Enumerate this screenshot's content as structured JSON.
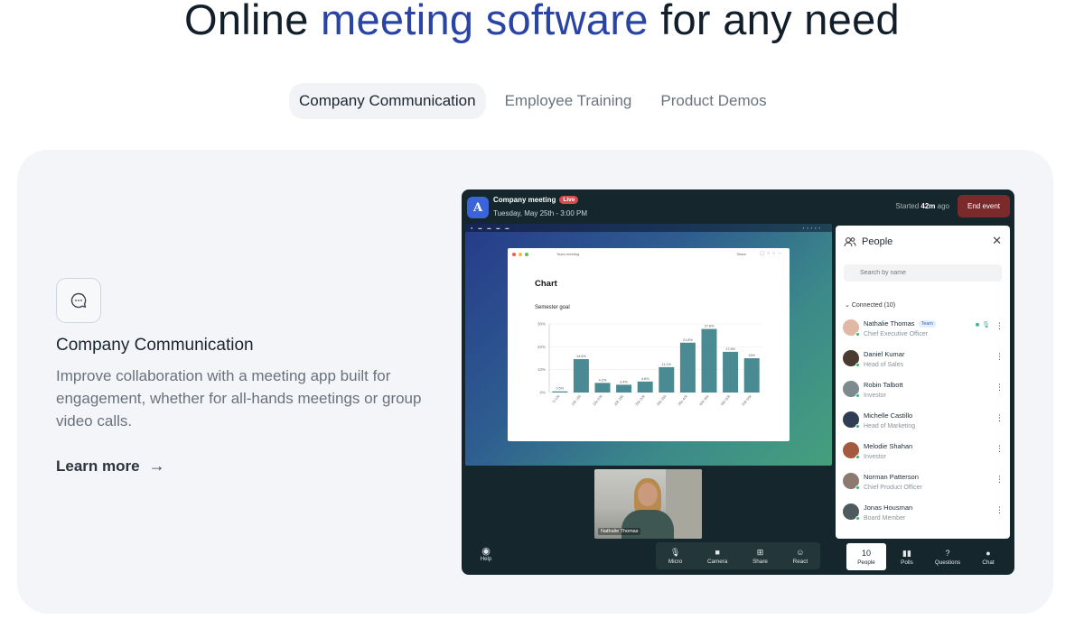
{
  "headline": {
    "pre": "Online ",
    "accent": "meeting software",
    "post": " for any need"
  },
  "tabs": [
    {
      "label": "Company Communication",
      "active": true
    },
    {
      "label": "Employee Training",
      "active": false
    },
    {
      "label": "Product Demos",
      "active": false
    }
  ],
  "feature": {
    "icon": "chat-bubble-icon",
    "title": "Company Communication",
    "description": "Improve collaboration with a meeting app built for engagement, whether for all-hands meetings or group video calls.",
    "link_label": "Learn more",
    "link_arrow": "→"
  },
  "app": {
    "logo_letter": "A",
    "meeting_title": "Company meeting",
    "live_badge": "Live",
    "meeting_date": "Tuesday, May 25th - 3:00 PM",
    "started_prefix": "Started ",
    "started_value": "42m",
    "started_suffix": " ago",
    "end_button": "End event",
    "shared_window": {
      "window_title": "Team meeting",
      "share_label": "Share",
      "chart_title": "Chart",
      "chart_subtitle": "Semester goal"
    },
    "thumbnail_name": "Nathalie Thomas",
    "help_label": "Help",
    "controls": [
      {
        "label": "Micro",
        "icon": "microphone-icon"
      },
      {
        "label": "Camera",
        "icon": "camera-icon"
      },
      {
        "label": "Share",
        "icon": "share-screen-icon"
      },
      {
        "label": "React",
        "icon": "smiley-icon"
      }
    ],
    "panel": {
      "title": "People",
      "search_placeholder": "Search by name",
      "connected_label": "Connected (10)",
      "people": [
        {
          "name": "Nathalie Thomas",
          "role": "Chief Executive Officer",
          "badge": "Team",
          "avatar_color": "#e0b9a4"
        },
        {
          "name": "Daniel Kumar",
          "role": "Head of Sales",
          "badge": "",
          "avatar_color": "#4b3a30"
        },
        {
          "name": "Robin Talbott",
          "role": "Investor",
          "badge": "",
          "avatar_color": "#7d8a90"
        },
        {
          "name": "Michelle Castillo",
          "role": "Head of Marketing",
          "badge": "",
          "avatar_color": "#2f3d55"
        },
        {
          "name": "Melodie Shahan",
          "role": "Investor",
          "badge": "",
          "avatar_color": "#a35a3e"
        },
        {
          "name": "Norman Patterson",
          "role": "Chief Product Officer",
          "badge": "",
          "avatar_color": "#8c7a70"
        },
        {
          "name": "Jonas Housman",
          "role": "Board Member",
          "badge": "",
          "avatar_color": "#4f5a5e"
        }
      ]
    },
    "panel_tabs": [
      {
        "label": "People",
        "count": "10",
        "active": true,
        "icon": "people-count"
      },
      {
        "label": "Polls",
        "active": false,
        "icon": "polls-icon"
      },
      {
        "label": "Questions",
        "active": false,
        "icon": "question-icon"
      },
      {
        "label": "Chat",
        "active": false,
        "icon": "chat-icon"
      }
    ]
  },
  "chart_data": {
    "type": "bar",
    "title": "Chart",
    "subtitle": "Semester goal",
    "categories": [
      "0-10k",
      "10k-15k",
      "15k-20k",
      "20k-25k",
      "25k-30k",
      "30k-35k",
      "35k-40k",
      "40k-45k",
      "45k-50k",
      "50k-55k"
    ],
    "values": [
      0.5,
      14.6,
      4.2,
      3.4,
      4.8,
      11.1,
      21.8,
      27.8,
      17.8,
      15.0
    ],
    "data_labels": [
      "0.5%",
      "14.6%",
      "4.2%",
      "3.4%",
      "4.8%",
      "11.1%",
      "21.8%",
      "27.8%",
      "17.8%",
      "15%"
    ],
    "y_ticks": [
      "0%",
      "10%",
      "20%",
      "30%"
    ],
    "ylim": [
      0,
      30
    ],
    "bar_color": "#4a8a92"
  }
}
